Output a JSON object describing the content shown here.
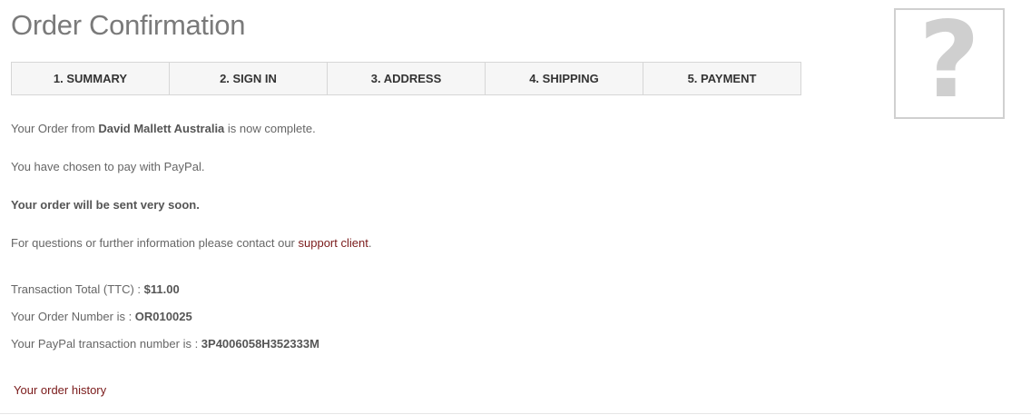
{
  "page": {
    "title": "Order Confirmation"
  },
  "steps": [
    {
      "label": "1. SUMMARY"
    },
    {
      "label": "2. SIGN IN"
    },
    {
      "label": "3. ADDRESS"
    },
    {
      "label": "4. SHIPPING"
    },
    {
      "label": "5. PAYMENT"
    }
  ],
  "placeholder_image": {
    "glyph": "?",
    "icon": "missing-image-icon"
  },
  "confirmation": {
    "line1_prefix": "Your Order from ",
    "shop_name": "David Mallett Australia",
    "line1_suffix": " is now complete.",
    "payment_method_text": "You have chosen to pay with PayPal.",
    "shipping_note": "Your order will be sent very soon.",
    "contact_prefix": "For questions or further information please contact our ",
    "contact_link": "support client",
    "contact_suffix": "."
  },
  "transaction": {
    "total_label": "Transaction Total (TTC) : ",
    "total_value": "$11.00",
    "order_number_label": "Your Order Number is : ",
    "order_number_value": "OR010025",
    "paypal_label": "Your PayPal transaction number is : ",
    "paypal_value": "3P4006058H352333M"
  },
  "history_link": "Your order history",
  "colors": {
    "link": "#7a1a1a",
    "text": "#666666",
    "heading": "#7a7a7a"
  }
}
